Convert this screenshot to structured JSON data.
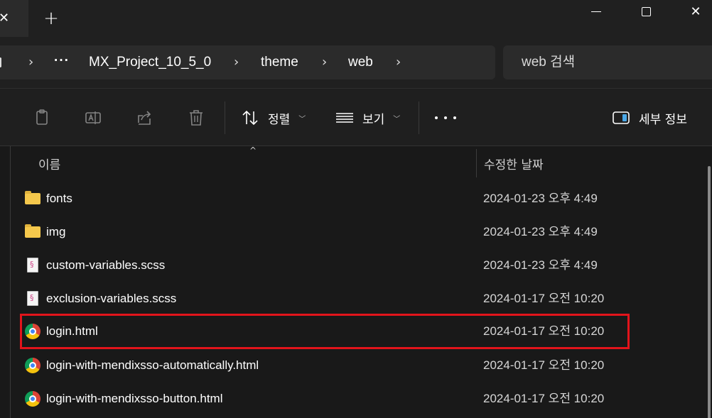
{
  "titlebar": {
    "tab_close_glyph": "✕",
    "new_tab_glyph": "+",
    "close_glyph": "✕"
  },
  "address": {
    "overflow": "···",
    "crumbs": [
      "MX_Project_10_5_0",
      "theme",
      "web"
    ],
    "chevron": "›",
    "search_placeholder": "web 검색"
  },
  "commands": {
    "sort_label": "정렬",
    "view_label": "보기",
    "details_label": "세부 정보",
    "icons": [
      "copy-icon",
      "rename-icon",
      "share-icon",
      "delete-icon",
      "sort-icon",
      "view-icon",
      "more-icon",
      "details-pane-icon"
    ]
  },
  "list": {
    "col_name": "이름",
    "col_date": "수정한 날짜",
    "sort_indicator": "^",
    "rows": [
      {
        "name": "fonts",
        "date": "2024-01-23 오후 4:49",
        "type": "folder"
      },
      {
        "name": "img",
        "date": "2024-01-23 오후 4:49",
        "type": "folder"
      },
      {
        "name": "custom-variables.scss",
        "date": "2024-01-23 오후 4:49",
        "type": "scss"
      },
      {
        "name": "exclusion-variables.scss",
        "date": "2024-01-17 오전 10:20",
        "type": "scss"
      },
      {
        "name": "login.html",
        "date": "2024-01-17 오전 10:20",
        "type": "html",
        "highlighted": true
      },
      {
        "name": "login-with-mendixsso-automatically.html",
        "date": "2024-01-17 오전 10:20",
        "type": "html"
      },
      {
        "name": "login-with-mendixsso-button.html",
        "date": "2024-01-17 오전 10:20",
        "type": "html"
      }
    ]
  },
  "colors": {
    "highlight": "#e2141b",
    "background": "#191919",
    "folder": "#f5c84c"
  }
}
